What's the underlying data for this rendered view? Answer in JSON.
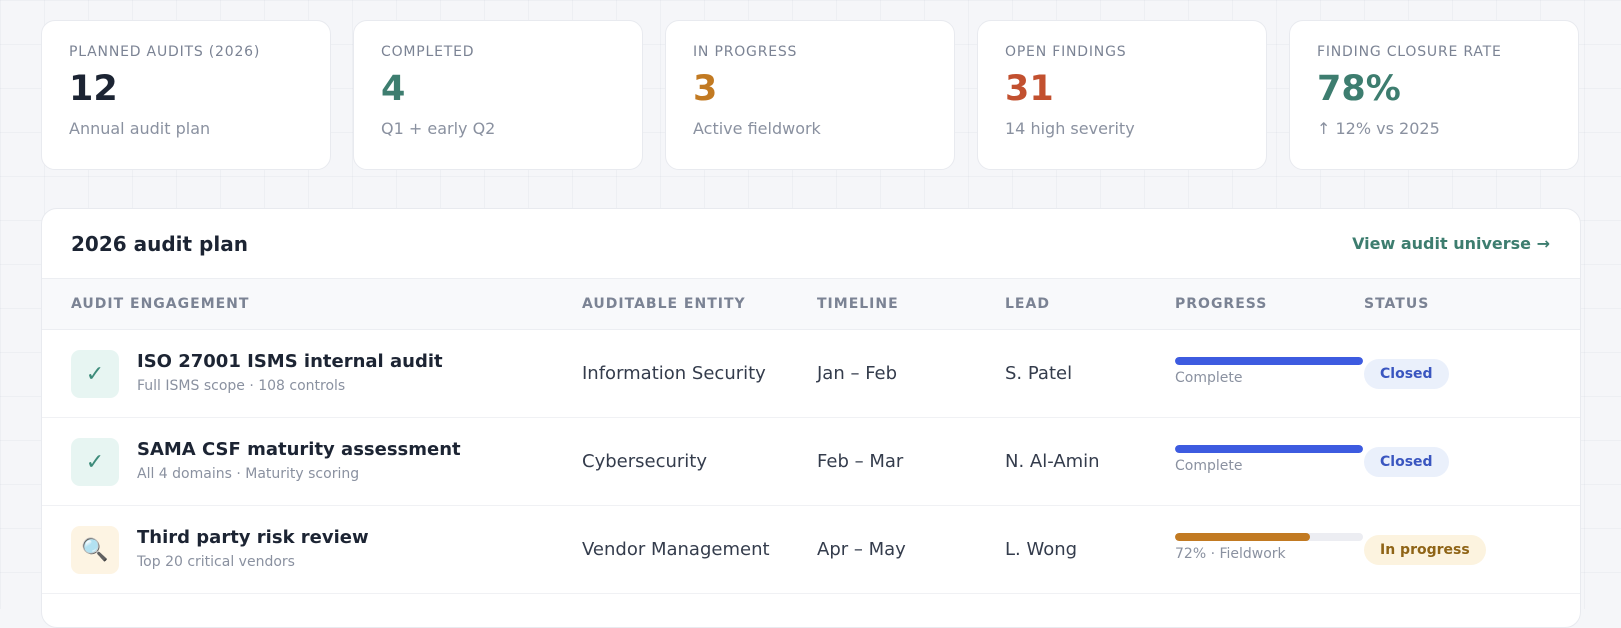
{
  "kpis": [
    {
      "label": "PLANNED AUDITS (2026)",
      "value": "12",
      "sub": "Annual audit plan",
      "color": "#1c2433"
    },
    {
      "label": "COMPLETED",
      "value": "4",
      "sub": "Q1 + early Q2",
      "color": "#3d7d6f"
    },
    {
      "label": "IN PROGRESS",
      "value": "3",
      "sub": "Active fieldwork",
      "color": "#c27a22"
    },
    {
      "label": "OPEN FINDINGS",
      "value": "31",
      "sub": "14 high severity",
      "color": "#c2502f"
    },
    {
      "label": "FINDING CLOSURE RATE",
      "value": "78%",
      "sub": "↑ 12% vs 2025",
      "color": "#3d7d6f"
    }
  ],
  "panel": {
    "title": "2026 audit plan",
    "link": "View audit universe →",
    "columns": [
      "AUDIT ENGAGEMENT",
      "AUDITABLE ENTITY",
      "TIMELINE",
      "LEAD",
      "PROGRESS",
      "STATUS"
    ],
    "rows": [
      {
        "icon": "check-icon",
        "icon_glyph": "✓",
        "title": "ISO 27001 ISMS internal audit",
        "sub": "Full ISMS scope · 108 controls",
        "entity": "Information Security",
        "timeline": "Jan – Feb",
        "lead": "S. Patel",
        "progress": 100,
        "progress_color": "#3d5be0",
        "progress_label": "Complete",
        "status": "Closed"
      },
      {
        "icon": "check-icon",
        "icon_glyph": "✓",
        "title": "SAMA CSF maturity assessment",
        "sub": "All 4 domains · Maturity scoring",
        "entity": "Cybersecurity",
        "timeline": "Feb – Mar",
        "lead": "N. Al-Amin",
        "progress": 100,
        "progress_color": "#3d5be0",
        "progress_label": "Complete",
        "status": "Closed"
      },
      {
        "icon": "search-icon",
        "icon_glyph": "🔍",
        "title": "Third party risk review",
        "sub": "Top 20 critical vendors",
        "entity": "Vendor Management",
        "timeline": "Apr – May",
        "lead": "L. Wong",
        "progress": 72,
        "progress_color": "#c27a22",
        "progress_label": "72% · Fieldwork",
        "status": "In progress"
      }
    ]
  }
}
